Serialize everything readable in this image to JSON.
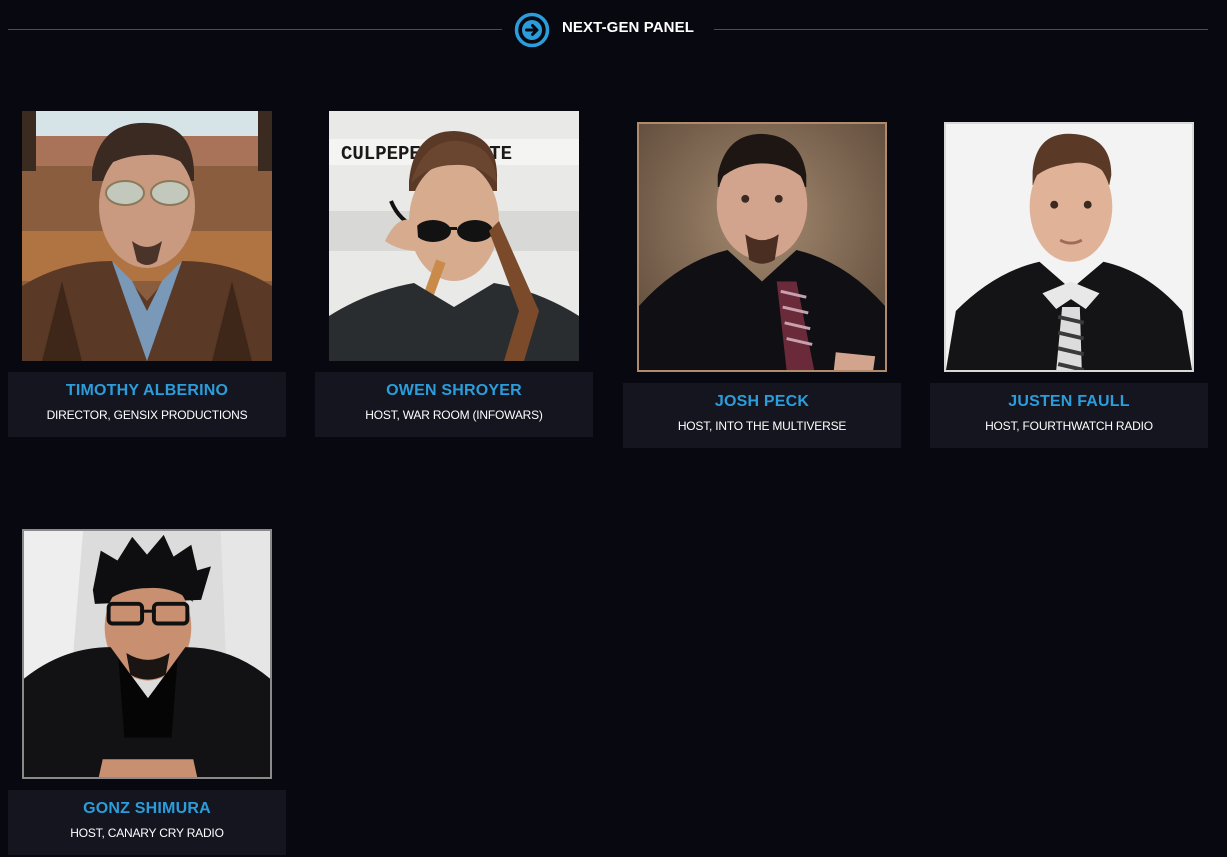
{
  "section": {
    "title": "NEXT-GEN PANEL",
    "icon": "arrow-right-circle-icon",
    "accent_color": "#2b9ddb"
  },
  "panelists": [
    {
      "name": "TIMOTHY ALBERINO",
      "role": "DIRECTOR, GENSIX PRODUCTIONS",
      "photo_text": ""
    },
    {
      "name": "OWEN SHROYER",
      "role": "HOST, WAR ROOM (INFOWARS)",
      "photo_text": "CULPEPER MINUTE"
    },
    {
      "name": "JOSH PECK",
      "role": "HOST, INTO THE MULTIVERSE",
      "photo_text": ""
    },
    {
      "name": "JUSTEN FAULL",
      "role": "HOST, FOURTHWATCH RADIO",
      "photo_text": ""
    },
    {
      "name": "GONZ SHIMURA",
      "role": "HOST, CANARY CRY RADIO",
      "photo_text": ""
    }
  ]
}
